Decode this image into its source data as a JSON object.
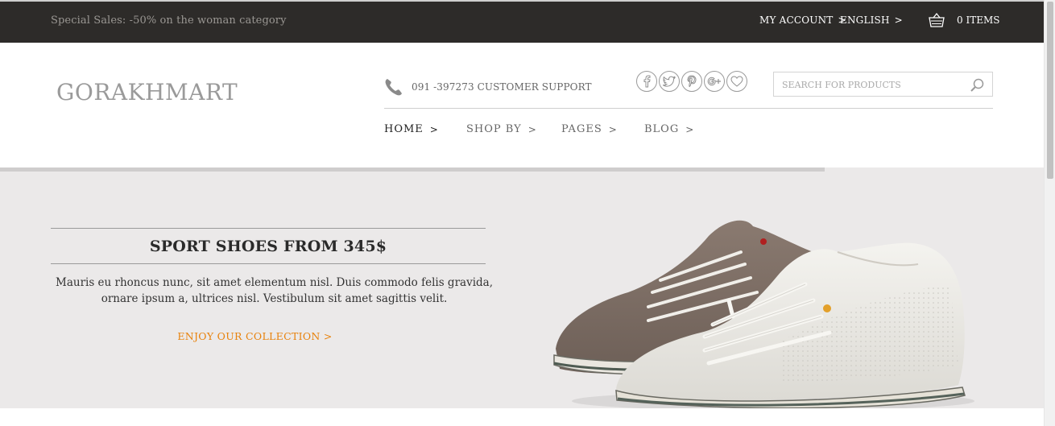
{
  "topbar": {
    "promo": "Special Sales: -50% on the woman category",
    "account_label": "MY ACCOUNT",
    "language_label": "ENGLISH",
    "cart_count": "0 ITEMS",
    "chevron": ">"
  },
  "header": {
    "logo": "GORAKHMART",
    "support": "091 -397273 CUSTOMER SUPPORT",
    "search_placeholder": "SEARCH FOR PRODUCTS",
    "socials": [
      "facebook-icon",
      "twitter-icon",
      "pinterest-icon",
      "google-plus-icon",
      "heart-icon"
    ]
  },
  "nav": {
    "items": [
      {
        "label": "HOME",
        "active": true
      },
      {
        "label": "SHOP BY",
        "active": false
      },
      {
        "label": "PAGES",
        "active": false
      },
      {
        "label": "BLOG",
        "active": false
      }
    ],
    "chevron": ">"
  },
  "hero": {
    "title": "SPORT SHOES FROM 345$",
    "description": "Mauris eu rhoncus nunc, sit amet elementum nisl. Duis commodo felis gravida, ornare ipsum a, ultrices nisl. Vestibulum sit amet sagittis velit.",
    "cta": "ENJOY OUR COLLECTION >",
    "slide_progress": 0.79
  },
  "colors": {
    "topbar_bg": "#2d2b29",
    "accent": "#e8820c",
    "hero_bg": "#ebe9e9"
  }
}
